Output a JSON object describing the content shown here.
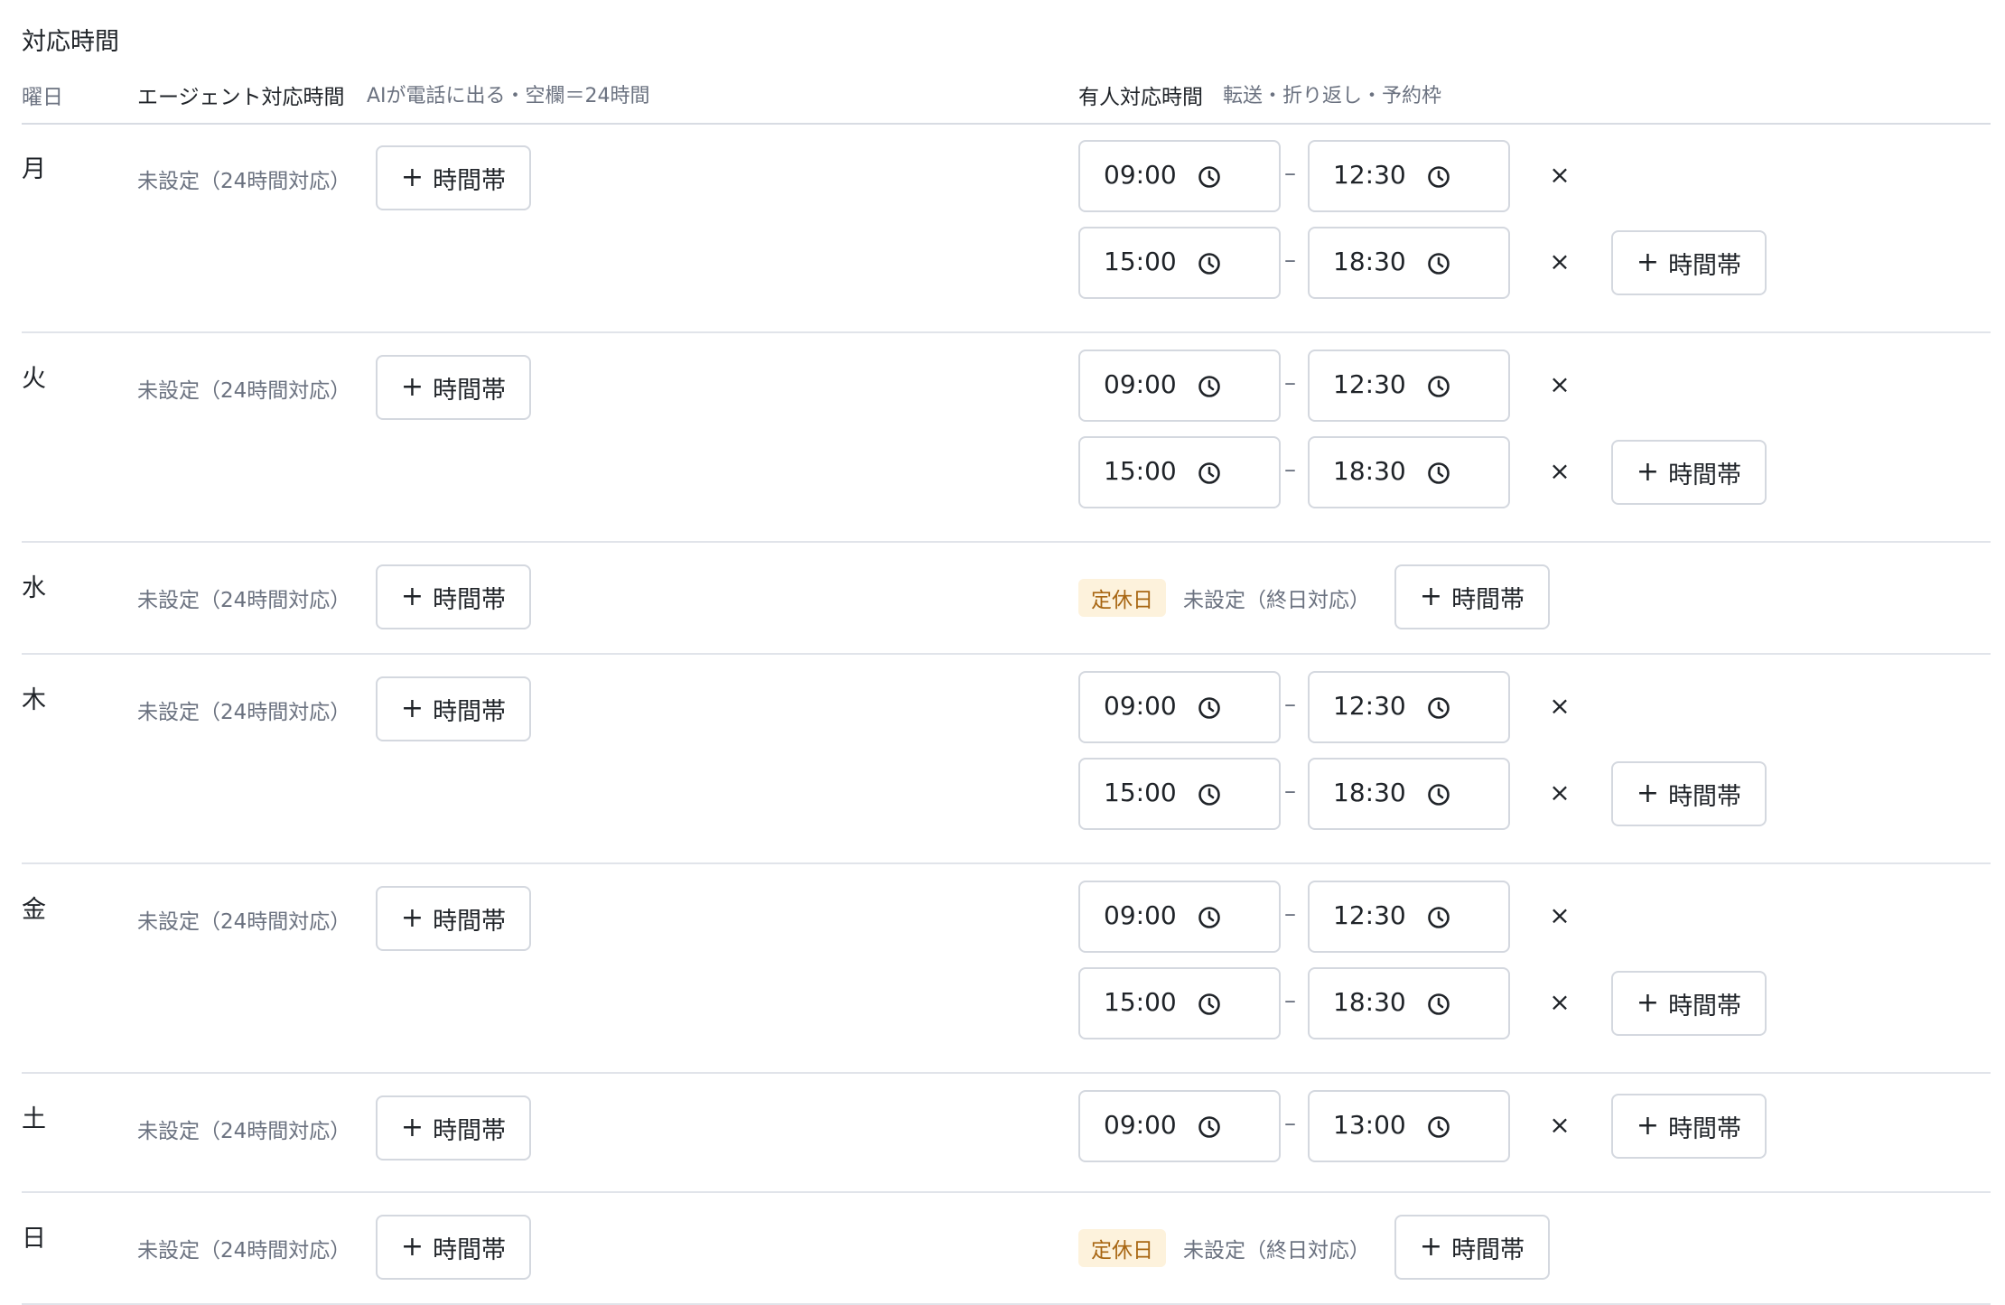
{
  "section_title": "対応時間",
  "headers": {
    "day": "曜日",
    "agent": "エージェント対応時間",
    "agent_sub": "AIが電話に出る・空欄＝24時間",
    "human": "有人対応時間",
    "human_sub": "転送・折り返し・予約枠"
  },
  "labels": {
    "agent_unset": "未設定（24時間対応）",
    "add_slot": "時間帯",
    "dash": "–",
    "remove": "×",
    "holiday": "定休日",
    "human_unset": "未設定（終日対応）"
  },
  "days": [
    {
      "day": "月",
      "slots": [
        {
          "start": "09:00",
          "end": "12:30"
        },
        {
          "start": "15:00",
          "end": "18:30"
        }
      ]
    },
    {
      "day": "火",
      "slots": [
        {
          "start": "09:00",
          "end": "12:30"
        },
        {
          "start": "15:00",
          "end": "18:30"
        }
      ]
    },
    {
      "day": "水",
      "holiday": true
    },
    {
      "day": "木",
      "slots": [
        {
          "start": "09:00",
          "end": "12:30"
        },
        {
          "start": "15:00",
          "end": "18:30"
        }
      ]
    },
    {
      "day": "金",
      "slots": [
        {
          "start": "09:00",
          "end": "12:30"
        },
        {
          "start": "15:00",
          "end": "18:30"
        }
      ]
    },
    {
      "day": "土",
      "slots": [
        {
          "start": "09:00",
          "end": "13:00"
        }
      ]
    },
    {
      "day": "日",
      "holiday": true
    }
  ],
  "colors": {
    "border": "#d4d8df",
    "muted_text": "#6b7280",
    "holiday_bg": "#fdf2dc",
    "holiday_text": "#a86612"
  }
}
